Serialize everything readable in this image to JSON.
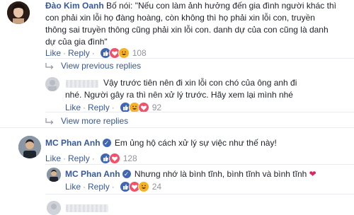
{
  "comment1": {
    "author": "Đào Kim Oanh",
    "text_line1_rest": " Bố nói: \"Nếu con làm ảnh hưởng đến gia đình người khác thì",
    "text_line2": "con phải xin lỗi họ đàng hoàng, còn không thì họ phải xin lỗi con, truyền",
    "text_line3": "thông sai truyền thông cũng phải xin lỗi con. danh dự của con cũng là danh",
    "text_line4": "dự của gia đình\"",
    "like": "Like",
    "reply": "Reply",
    "count": "108"
  },
  "view_more_1": "View previous replies",
  "comment2": {
    "text_line1": "Vậy trước tiên nên đi xin lỗi con chó của ông anh đi",
    "text_line2": "nhé. Người gây ra thì nên xử lý trước. Hãy xem lại mình nhé",
    "like": "Like",
    "reply": "Reply",
    "count": "92"
  },
  "view_more_2": "View more replies",
  "comment3": {
    "author": "MC Phan Anh",
    "text": "Em ủng hộ cách xử lý sự việc như thế này!",
    "like": "Like",
    "reply": "Reply",
    "count": "128"
  },
  "comment4": {
    "author": "MC Phan Anh",
    "text": "Nhưng nhớ là bình tĩnh, bình tĩnh và bình tĩnh",
    "heart": "❤",
    "like": "Like",
    "reply": "Reply",
    "count": "24"
  },
  "icons": {
    "verified_glyph": "✓",
    "chevron": "›"
  },
  "colors": {
    "link": "#385898",
    "muted": "#90949c",
    "like_blue": "#4267b2",
    "love_red": "#f25268",
    "haha_yellow": "#f7b125"
  }
}
